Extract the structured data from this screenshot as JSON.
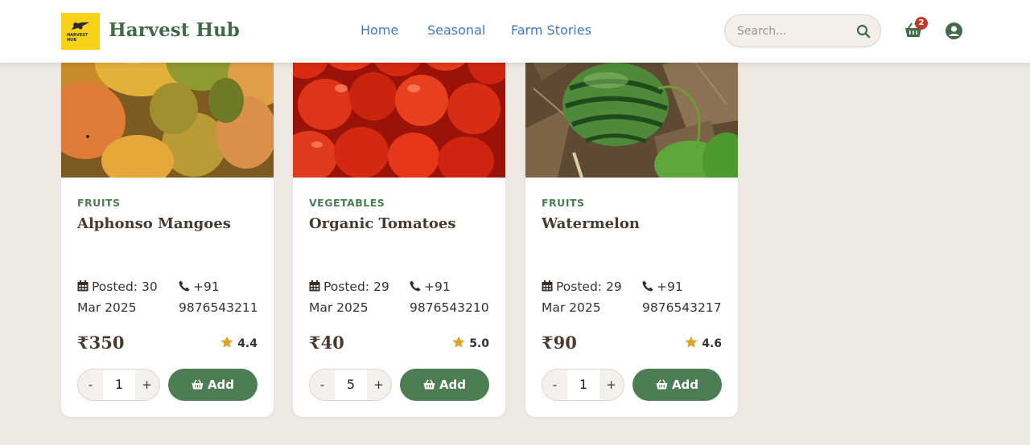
{
  "header": {
    "logo_text": "HARVEST HUB",
    "brand": "Harvest Hub",
    "nav": [
      "Home",
      "Seasonal",
      "Farm Stories"
    ],
    "search_placeholder": "Search...",
    "cart_count": "2",
    "icons": {
      "search": "search-icon",
      "cart": "basket-icon",
      "user": "user-circle-icon"
    }
  },
  "products": [
    {
      "category": "FRUITS",
      "name": "Alphonso Mangoes",
      "posted_line1": "Posted: 30",
      "posted_line2": "Mar 2025",
      "phone_line1": "+91",
      "phone_line2": "9876543211",
      "price": "₹350",
      "rating": "4.4",
      "qty": "1",
      "minus": "-",
      "plus": "+",
      "add_label": "Add"
    },
    {
      "category": "VEGETABLES",
      "name": "Organic Tomatoes",
      "posted_line1": "Posted: 29",
      "posted_line2": "Mar 2025",
      "phone_line1": "+91",
      "phone_line2": "9876543210",
      "price": "₹40",
      "rating": "5.0",
      "qty": "5",
      "minus": "-",
      "plus": "+",
      "add_label": "Add"
    },
    {
      "category": "FRUITS",
      "name": "Watermelon",
      "posted_line1": "Posted: 29",
      "posted_line2": "Mar 2025",
      "phone_line1": "+91",
      "phone_line2": "9876543217",
      "price": "₹90",
      "rating": "4.6",
      "qty": "1",
      "minus": "-",
      "plus": "+",
      "add_label": "Add"
    }
  ],
  "colors": {
    "brand_green": "#3f6b47",
    "add_button": "#4d7d52",
    "nav_link": "#3d79c8",
    "star": "#e0a224",
    "badge": "#c0392b",
    "background": "#efe9e3"
  }
}
